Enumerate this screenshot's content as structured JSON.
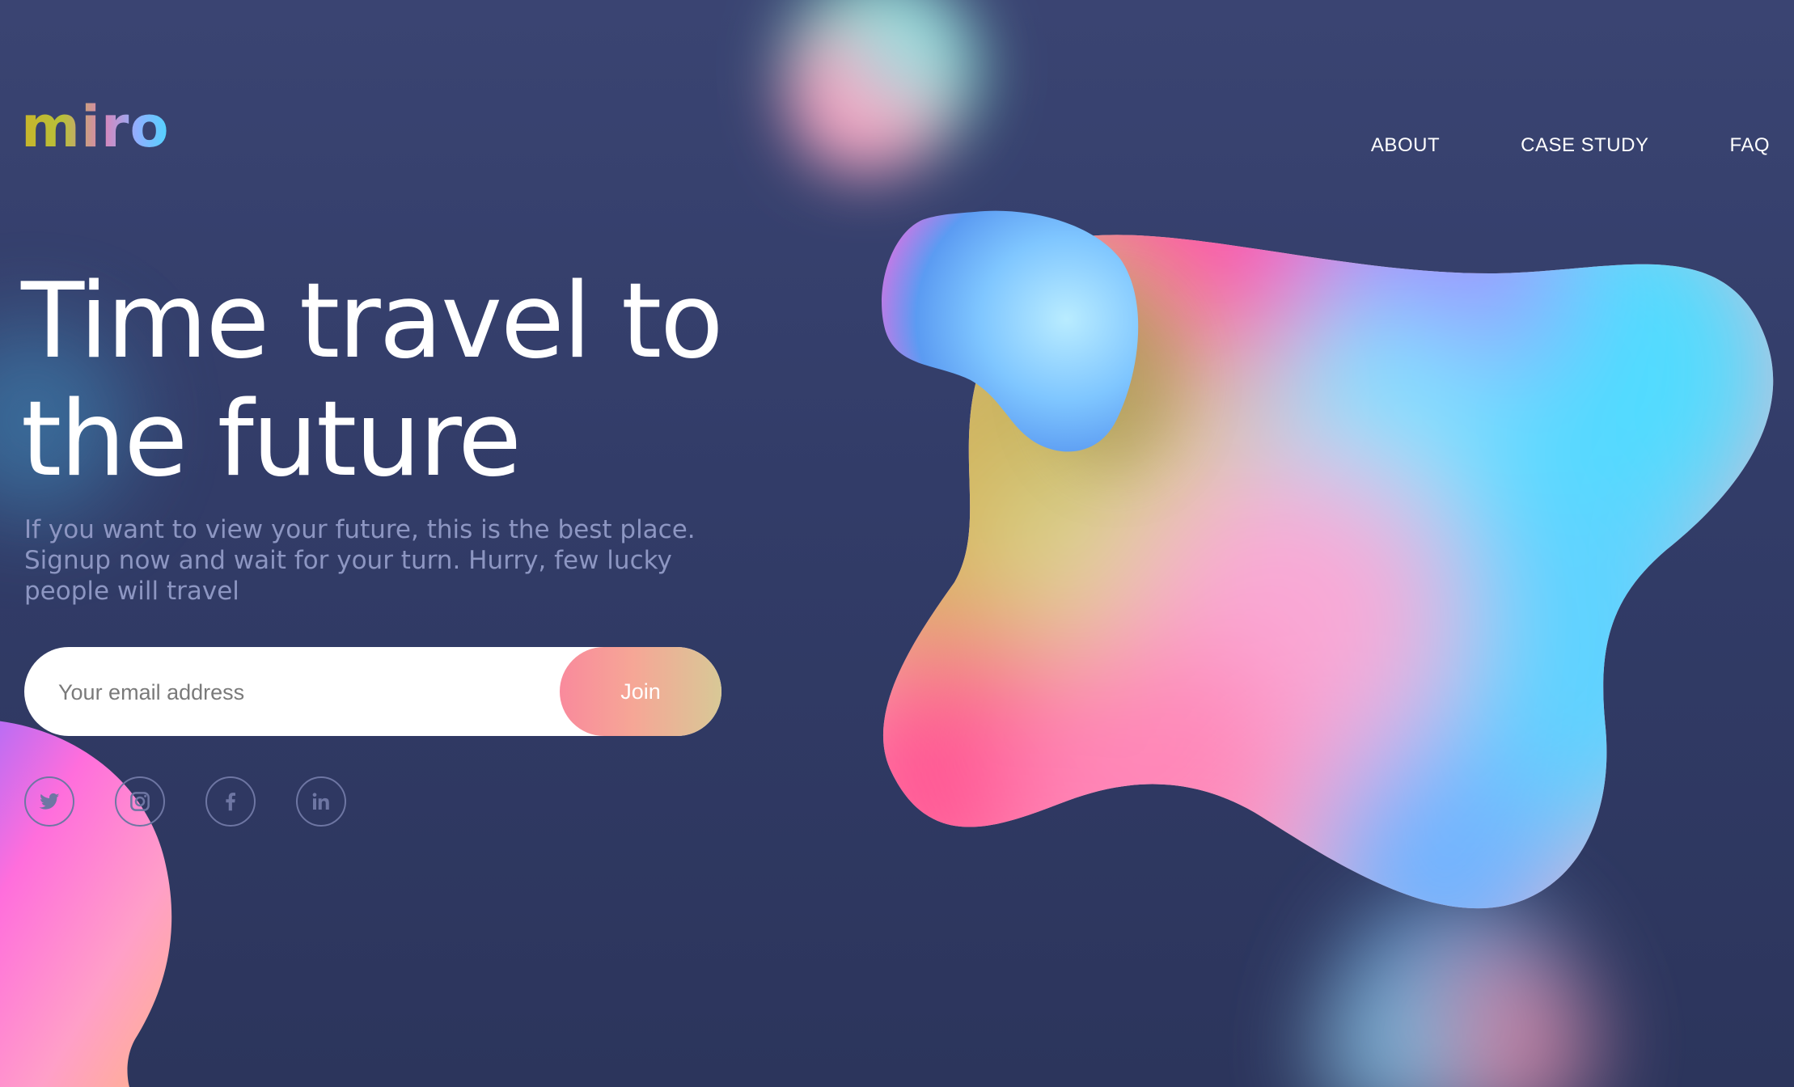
{
  "brand": {
    "logo": "miro"
  },
  "nav": {
    "items": [
      "ABOUT",
      "CASE STUDY",
      "FAQ"
    ]
  },
  "hero": {
    "title_line1": "Time travel to",
    "title_line2": "the future",
    "subtitle_line1": "If you want to view your future, this is the best place.",
    "subtitle_line2": "Signup now and wait for your turn. Hurry, few lucky",
    "subtitle_line3": "people will travel"
  },
  "signup": {
    "email_placeholder": "Your email address",
    "join_label": "Join"
  },
  "social": {
    "icons": [
      "twitter-icon",
      "instagram-icon",
      "facebook-icon",
      "linkedin-icon"
    ]
  },
  "colors": {
    "background": "#353f6c",
    "text_primary": "#ffffff",
    "text_muted": "#8d96c2",
    "join_gradient_start": "#f98a9c",
    "join_gradient_end": "#d8c896"
  }
}
